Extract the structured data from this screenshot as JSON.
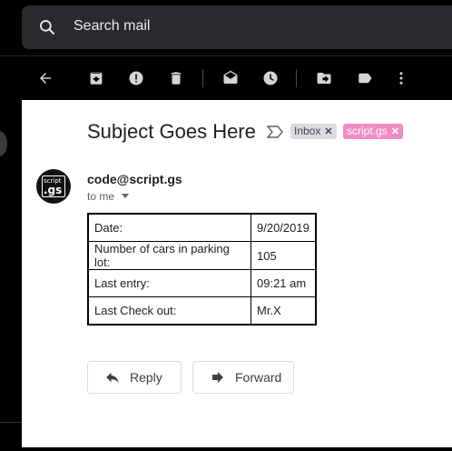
{
  "search": {
    "placeholder": "Search mail"
  },
  "message": {
    "subject": "Subject Goes Here",
    "labels": [
      {
        "name": "Inbox",
        "color": "#dadce0"
      },
      {
        "name": "script.gs",
        "color": "#f08cc4"
      }
    ],
    "sender": "code@script.gs",
    "recipient": "to me",
    "avatar": {
      "line1": "script",
      "line2": ".gs"
    },
    "table": {
      "rows": [
        {
          "key": "Date:",
          "value": "9/20/2019"
        },
        {
          "key": "Number of cars in parking lot:",
          "value": "105"
        },
        {
          "key": "Last entry:",
          "value": "09:21 am"
        },
        {
          "key": "Last Check out:",
          "value": "Mr.X"
        }
      ]
    }
  },
  "actions": {
    "reply": "Reply",
    "forward": "Forward"
  },
  "icons": {
    "toolbar": [
      "back-arrow-icon",
      "archive-icon",
      "report-spam-icon",
      "delete-icon",
      "mark-unread-icon",
      "snooze-icon",
      "move-to-icon",
      "label-icon",
      "more-vert-icon"
    ]
  }
}
